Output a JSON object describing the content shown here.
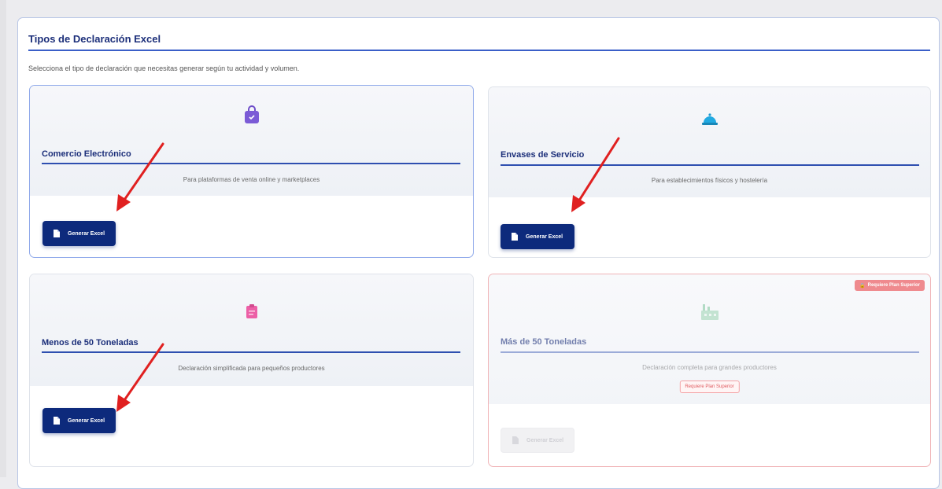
{
  "panel": {
    "title": "Tipos de Declaración Excel",
    "description": "Selecciona el tipo de declaración que necesitas generar según tu actividad y volumen."
  },
  "cards": [
    {
      "title": "Comercio Electrónico",
      "subtitle": "Para plataformas de venta online y marketplaces",
      "button_label": "Generar Excel",
      "icon": "shopping-bag-icon",
      "accent": "#7b5bd6"
    },
    {
      "title": "Envases de Servicio",
      "subtitle": "Para establecimientos físicos y hostelería",
      "button_label": "Generar Excel",
      "icon": "service-bell-icon",
      "accent": "#21a9e1"
    },
    {
      "title": "Menos de 50 Toneladas",
      "subtitle": "Declaración simplificada para pequeños productores",
      "button_label": "Generar Excel",
      "icon": "clipboard-icon",
      "accent": "#ec5fa6"
    },
    {
      "title": "Más de 50 Toneladas",
      "subtitle": "Declaración completa para grandes productores",
      "button_label": "Generar Excel",
      "icon": "factory-icon",
      "accent": "#7bc49a",
      "locked": true,
      "badge": "Requiere Plan Superior",
      "requirement": "Requiere Plan Superior"
    }
  ],
  "colors": {
    "primary": "#0d2a7c",
    "title": "#1c2f7a",
    "lock": "#ef8a8e",
    "arrow": "#e02020"
  }
}
